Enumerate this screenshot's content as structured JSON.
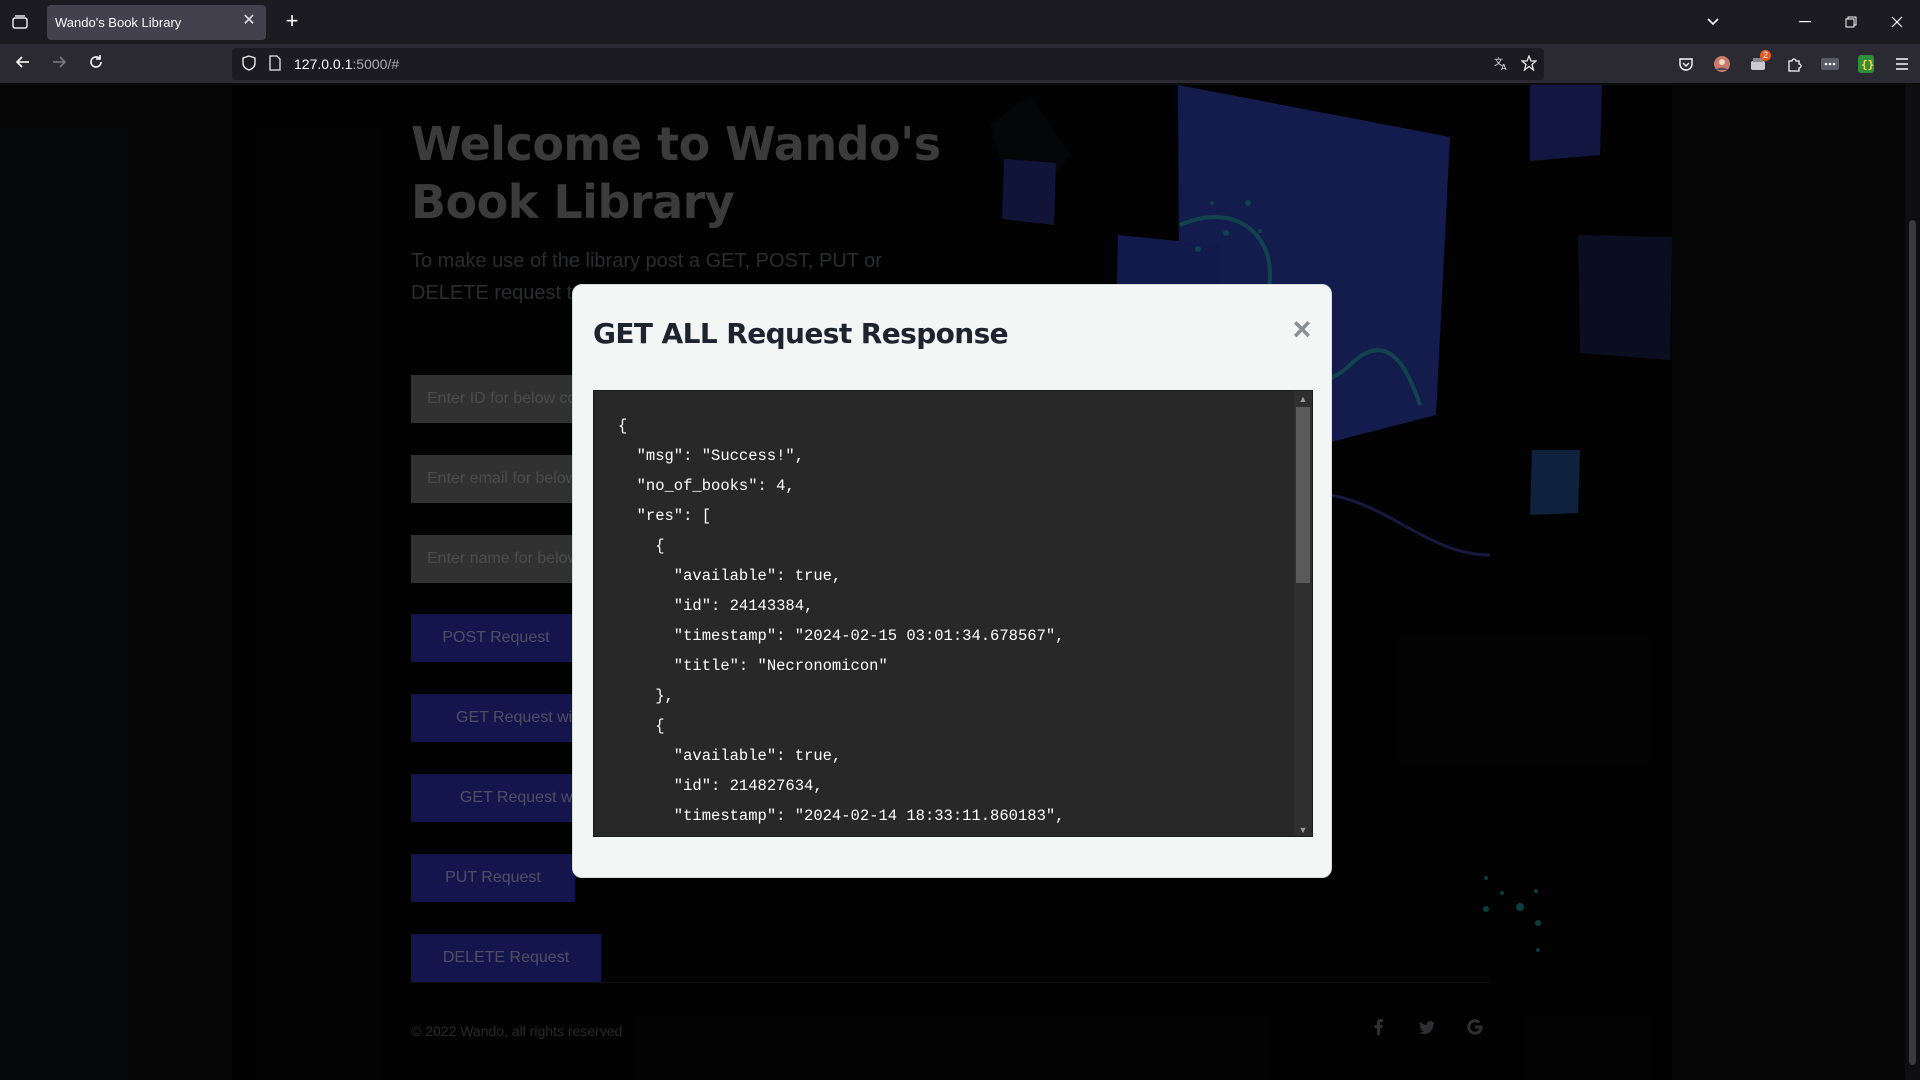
{
  "browser": {
    "tab_title": "Wando's Book Library",
    "url_host": "127.0.0.1",
    "url_rest": ":5000/#",
    "tab_close_glyph": "✕",
    "new_tab_glyph": "+",
    "extension_badge": "2"
  },
  "page": {
    "title": "Welcome to Wando's Book Library",
    "description": "To make use of the library post a GET, POST, PUT or DELETE request to the backend use the below buttons",
    "fields": [
      {
        "placeholder": "Enter ID for below commands"
      },
      {
        "placeholder": "Enter email for below commands"
      },
      {
        "placeholder": "Enter name for below commands"
      }
    ],
    "buttons": {
      "post": "POST Request",
      "get_id": "GET Request with ID",
      "get_all": "GET Request without ID",
      "put": "PUT Request",
      "delete": "DELETE Request"
    },
    "copyright": "© 2022 Wando, all rights reserved",
    "social": [
      "facebook-icon",
      "twitter-icon",
      "google-icon"
    ]
  },
  "modal": {
    "title": "GET ALL Request Response",
    "close_glyph": "×",
    "response_lines": [
      "{",
      "  \"msg\": \"Success!\",",
      "  \"no_of_books\": 4,",
      "  \"res\": [",
      "    {",
      "      \"available\": true,",
      "      \"id\": 24143384,",
      "      \"timestamp\": \"2024-02-15 03:01:34.678567\",",
      "      \"title\": \"Necronomicon\"",
      "    },",
      "    {",
      "      \"available\": true,",
      "      \"id\": 214827634,",
      "      \"timestamp\": \"2024-02-14 18:33:11.860183\","
    ]
  }
}
